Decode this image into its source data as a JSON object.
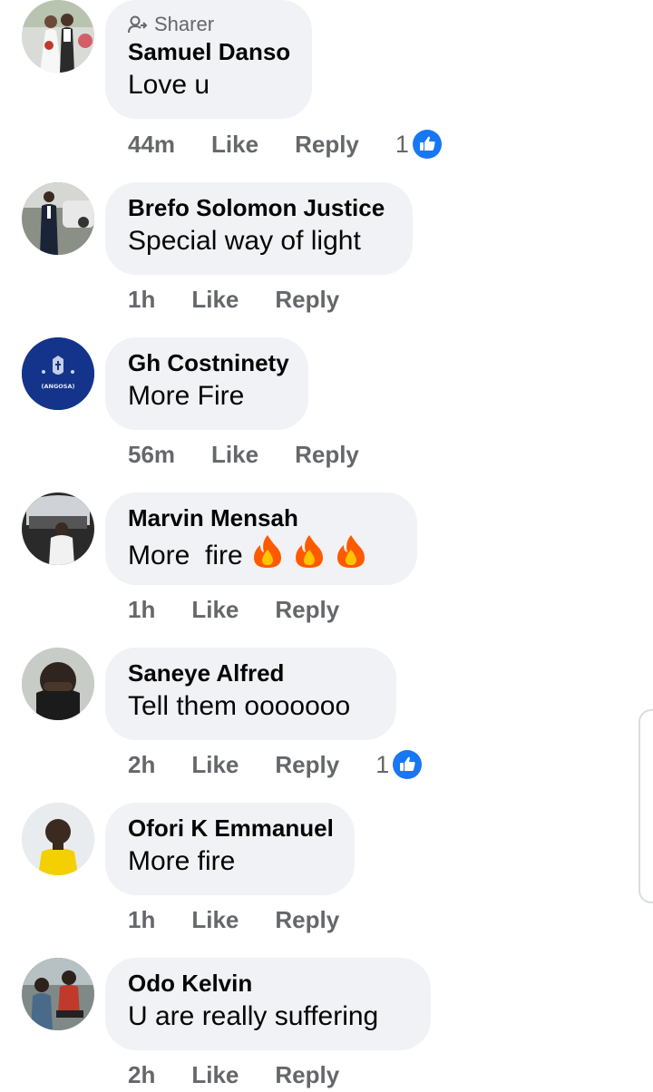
{
  "comments": [
    {
      "sharer_label": "Sharer",
      "author": "Samuel Danso",
      "text": "Love u",
      "time": "44m",
      "like_label": "Like",
      "reply_label": "Reply",
      "reaction_count": "1",
      "avatar": "wedding-couple-photo"
    },
    {
      "author": "Brefo Solomon Justice",
      "text": "Special way of light",
      "time": "1h",
      "like_label": "Like",
      "reply_label": "Reply",
      "avatar": "man-in-suit-by-car-photo"
    },
    {
      "author": "Gh Costninety",
      "text": "More Fire",
      "time": "56m",
      "like_label": "Like",
      "reply_label": "Reply",
      "avatar": "blue-school-logo",
      "avatar_text": "(ANGOSA)"
    },
    {
      "author": "Marvin Mensah",
      "text": "More  fire",
      "emoji": [
        "fire",
        "fire",
        "fire"
      ],
      "time": "1h",
      "like_label": "Like",
      "reply_label": "Reply",
      "avatar": "man-by-car-trunk-photo"
    },
    {
      "author": "Saneye Alfred",
      "text": "Tell them ooooooo",
      "time": "2h",
      "like_label": "Like",
      "reply_label": "Reply",
      "reaction_count": "1",
      "avatar": "man-hands-on-face-photo"
    },
    {
      "author": "Ofori K Emmanuel",
      "text": "More fire",
      "time": "1h",
      "like_label": "Like",
      "reply_label": "Reply",
      "avatar": "man-in-yellow-shirt-photo"
    },
    {
      "author": "Odo Kelvin",
      "text": "U are really suffering",
      "time": "2h",
      "like_label": "Like",
      "reply_label": "Reply",
      "avatar": "man-seated-outdoors-photo"
    }
  ],
  "colors": {
    "bubble": "#f0f2f5",
    "meta_text": "#65676b",
    "like_blue": "#1877f2",
    "fire_orange": "#ff6d00"
  }
}
